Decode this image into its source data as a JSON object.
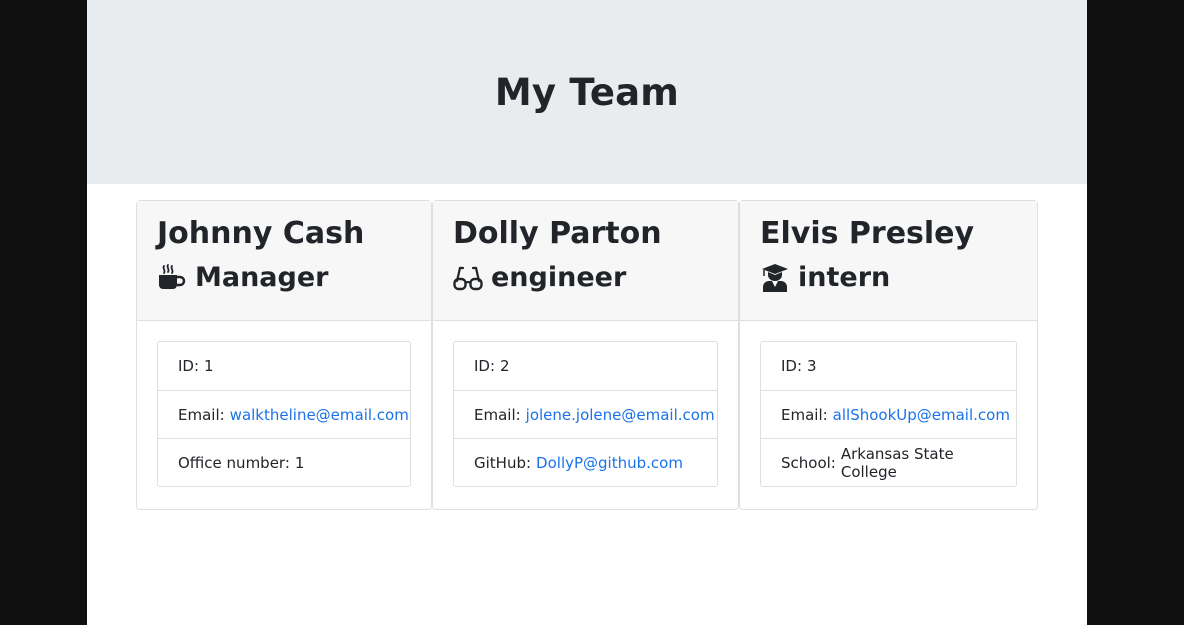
{
  "header": {
    "title": "My Team"
  },
  "icons": {
    "manager": "coffee-icon",
    "engineer": "glasses-icon",
    "intern": "user-graduate-icon"
  },
  "colors": {
    "link": "#1a73e8",
    "jumbotron_bg": "#e9ecef",
    "side_bg": "#0f0f0f"
  },
  "employees": [
    {
      "name": "Johnny Cash",
      "role": "Manager",
      "id_label": "ID:",
      "id": "1",
      "email_label": "Email:",
      "email": "walktheline@email.com",
      "extra_label": "Office number:",
      "extra": "1"
    },
    {
      "name": "Dolly Parton",
      "role": "engineer",
      "id_label": "ID:",
      "id": "2",
      "email_label": "Email:",
      "email": "jolene.jolene@email.com",
      "extra_label": "GitHub:",
      "extra": "DollyP@github.com"
    },
    {
      "name": "Elvis Presley",
      "role": "intern",
      "id_label": "ID:",
      "id": "3",
      "email_label": "Email:",
      "email": "allShookUp@email.com",
      "extra_label": "School:",
      "extra": "Arkansas State College"
    }
  ]
}
